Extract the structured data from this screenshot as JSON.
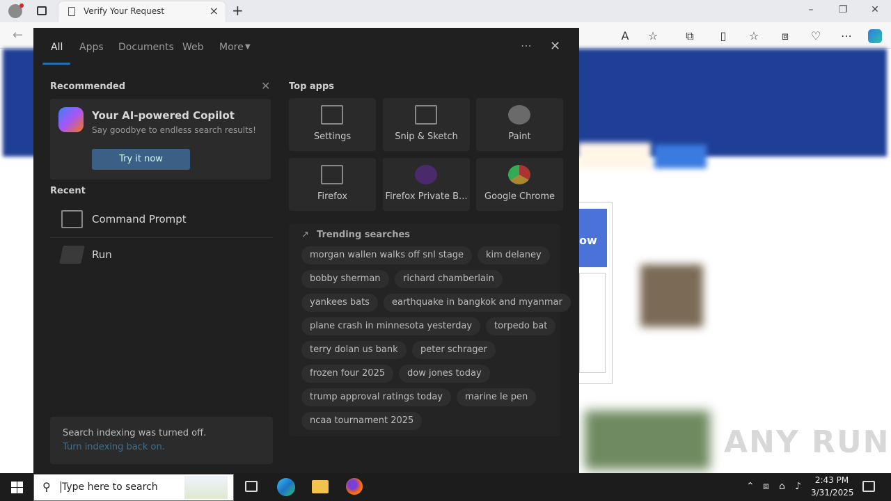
{
  "browser": {
    "tab_title": "Verify Your Request"
  },
  "page": {
    "blue_button_text": "ow",
    "watermark": "ANY RUN"
  },
  "search_panel": {
    "tabs": [
      "All",
      "Apps",
      "Documents",
      "Web",
      "More"
    ],
    "recommended": {
      "title": "Recommended",
      "card_title": "Your AI-powered Copilot",
      "card_subtitle": "Say goodbye to endless search results!",
      "card_button": "Try it now"
    },
    "recent": {
      "title": "Recent",
      "items": [
        "Command Prompt",
        "Run"
      ]
    },
    "top_apps": {
      "title": "Top apps",
      "items": [
        "Settings",
        "Snip & Sketch",
        "Paint",
        "Firefox",
        "Firefox Private B...",
        "Google Chrome"
      ]
    },
    "trending": {
      "title": "Trending searches",
      "items": [
        "morgan wallen walks off snl stage",
        "kim delaney",
        "bobby sherman",
        "richard chamberlain",
        "yankees bats",
        "earthquake in bangkok and myanmar",
        "plane crash in minnesota yesterday",
        "torpedo bat",
        "terry dolan us bank",
        "peter schrager",
        "frozen four 2025",
        "dow jones today",
        "trump approval ratings today",
        "marine le pen",
        "ncaa tournament 2025"
      ]
    },
    "indexing": {
      "message": "Search indexing was turned off.",
      "link": "Turn indexing back on."
    }
  },
  "taskbar": {
    "search_placeholder": "Type here to search",
    "time": "2:43 PM",
    "date": "3/31/2025"
  }
}
